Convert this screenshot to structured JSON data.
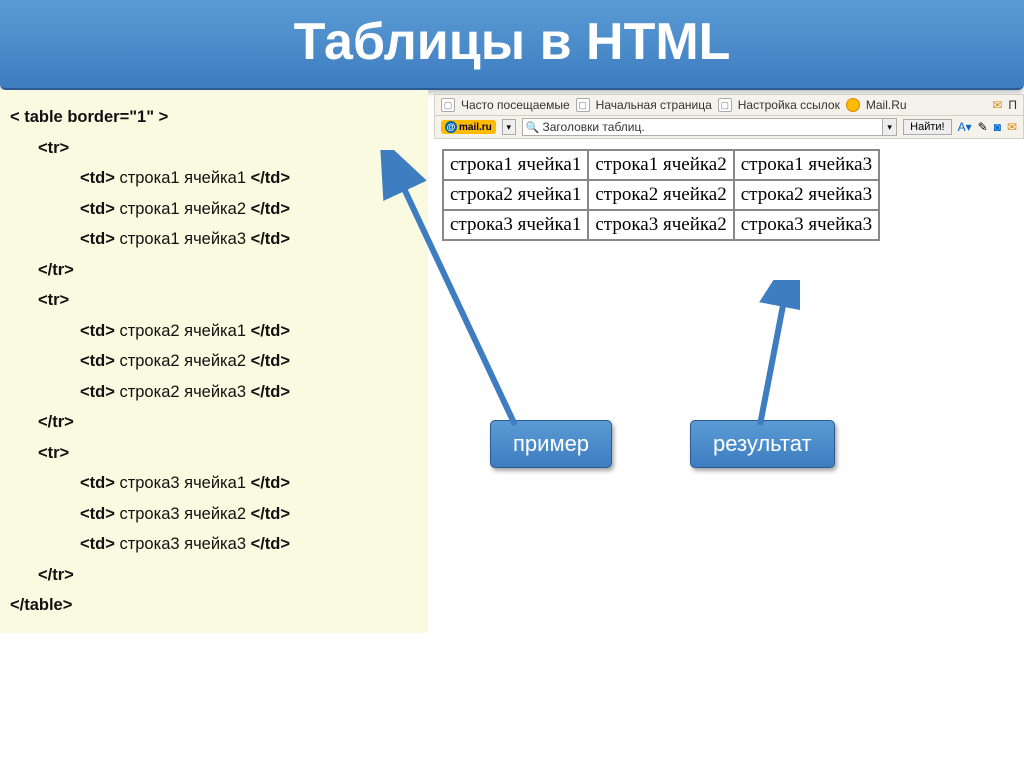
{
  "title": "Таблицы в HTML",
  "code": {
    "table_open": "< table border=\"1\" >",
    "tr_open": "<tr>",
    "tr_close": "</tr>",
    "table_close": "</table>",
    "td_open": "<td>",
    "td_close": "</td>",
    "rows": [
      "строка1",
      "строка2",
      "строка3"
    ],
    "cells": [
      "ячейка1",
      "ячейка2",
      "ячейка3"
    ]
  },
  "bookmarks": {
    "frequent": "Часто посещаемые",
    "startpage": "Начальная страница",
    "links": "Настройка ссылок",
    "mail": "Mail.Ru",
    "partial": "П"
  },
  "toolbar": {
    "brand": "mail.ru",
    "search_value": "Заголовки таблиц.",
    "find": "Найти!"
  },
  "callouts": {
    "example": "пример",
    "result": "результат"
  },
  "result_table": [
    [
      "строка1 ячейка1",
      "строка1 ячейка2",
      "строка1 ячейка3"
    ],
    [
      "строка2 ячейка1",
      "строка2 ячейка2",
      "строка2 ячейка3"
    ],
    [
      "строка3 ячейка1",
      "строка3 ячейка2",
      "строка3 ячейка3"
    ]
  ]
}
